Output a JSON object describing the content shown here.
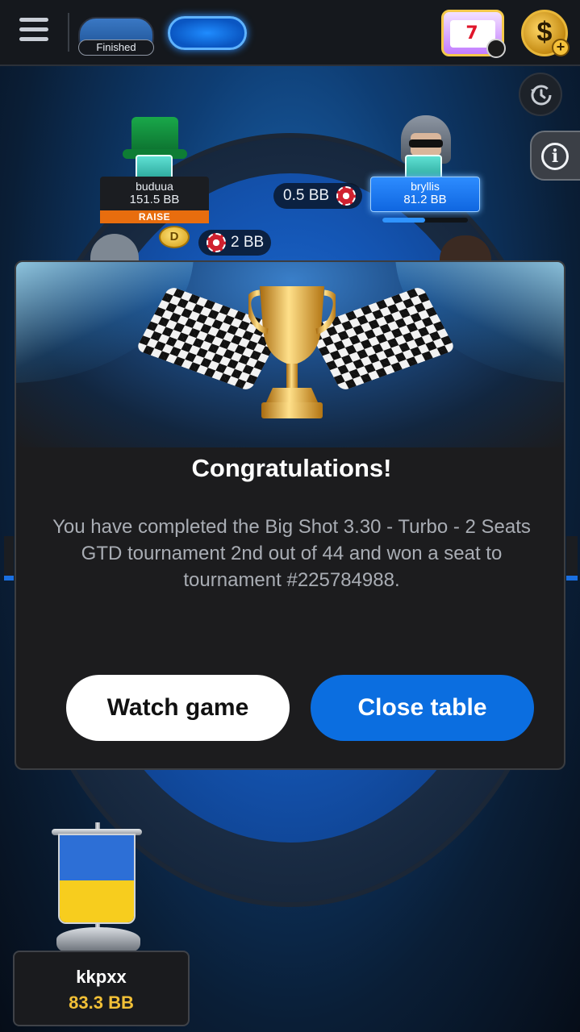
{
  "topbar": {
    "finished_label": "Finished"
  },
  "players": {
    "left": {
      "name": "buduua",
      "stack": "151.5 BB",
      "action": "RAISE",
      "bet": "2 BB"
    },
    "right": {
      "name": "bryllis",
      "stack": "81.2 BB",
      "bet": "0.5 BB",
      "timer_fraction": 0.5
    },
    "dealer_label": "D"
  },
  "modal": {
    "title": "Congratulations!",
    "message": "You have completed the Big Shot 3.30 - Turbo - 2 Seats GTD tournament 2nd out of 44 and won a seat to tournament #225784988.",
    "watch_label": "Watch game",
    "close_label": "Close table"
  },
  "hero": {
    "name": "kkpxx",
    "stack": "83.3 BB",
    "flag": "ukraine-flag"
  },
  "icons": {
    "menu": "hamburger-menu-icon",
    "slot": "slot-machine-icon",
    "coin": "dollar-coin-icon",
    "history": "history-icon",
    "info": "info-icon",
    "trophy": "trophy-icon"
  },
  "colors": {
    "accent_blue": "#0b6ee0",
    "raise_orange": "#e86d0e",
    "stack_gold": "#f2c037"
  }
}
